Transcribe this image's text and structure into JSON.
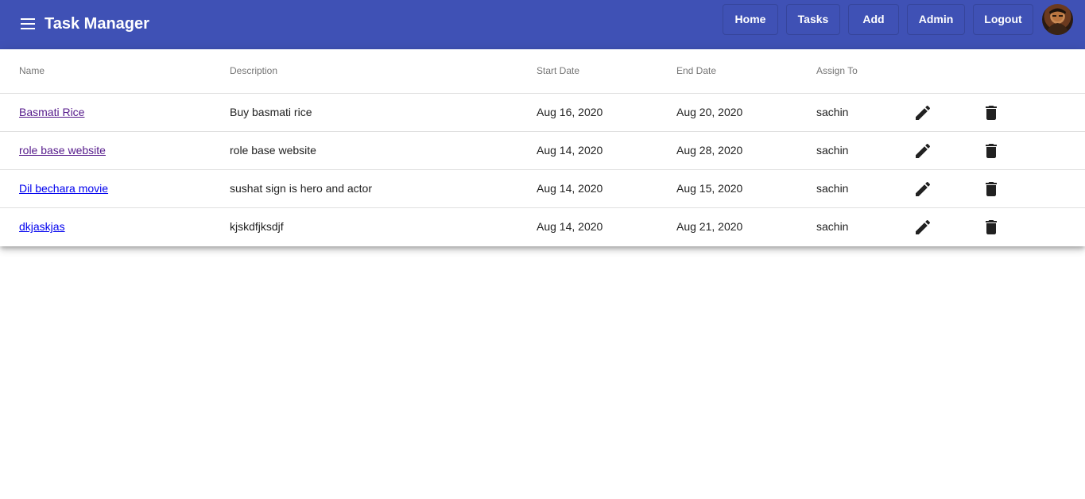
{
  "toolbar": {
    "title": "Task Manager",
    "menu_icon": "menu-icon",
    "nav": [
      {
        "label": "Home"
      },
      {
        "label": "Tasks"
      },
      {
        "label": "Add"
      },
      {
        "label": "Admin"
      },
      {
        "label": "Logout"
      }
    ],
    "avatar_icon": "user-avatar",
    "background_color": "#3f51b5"
  },
  "table": {
    "columns": [
      "Name",
      "Description",
      "Start Date",
      "End Date",
      "Assign To"
    ],
    "rows": [
      {
        "name": "Basmati Rice",
        "description": "Buy basmati rice",
        "start_date": "Aug 16, 2020",
        "end_date": "Aug 20, 2020",
        "assign_to": "sachin",
        "link_state": "visited"
      },
      {
        "name": "role base website",
        "description": "role base website",
        "start_date": "Aug 14, 2020",
        "end_date": "Aug 28, 2020",
        "assign_to": "sachin",
        "link_state": "visited"
      },
      {
        "name": "Dil bechara movie",
        "description": "sushat sign is hero and actor",
        "start_date": "Aug 14, 2020",
        "end_date": "Aug 15, 2020",
        "assign_to": "sachin",
        "link_state": "unvisited"
      },
      {
        "name": "dkjaskjas",
        "description": "kjskdfjksdjf",
        "start_date": "Aug 14, 2020",
        "end_date": "Aug 21, 2020",
        "assign_to": "sachin",
        "link_state": "unvisited"
      }
    ],
    "row_icons": [
      "edit-icon",
      "delete-icon"
    ]
  }
}
